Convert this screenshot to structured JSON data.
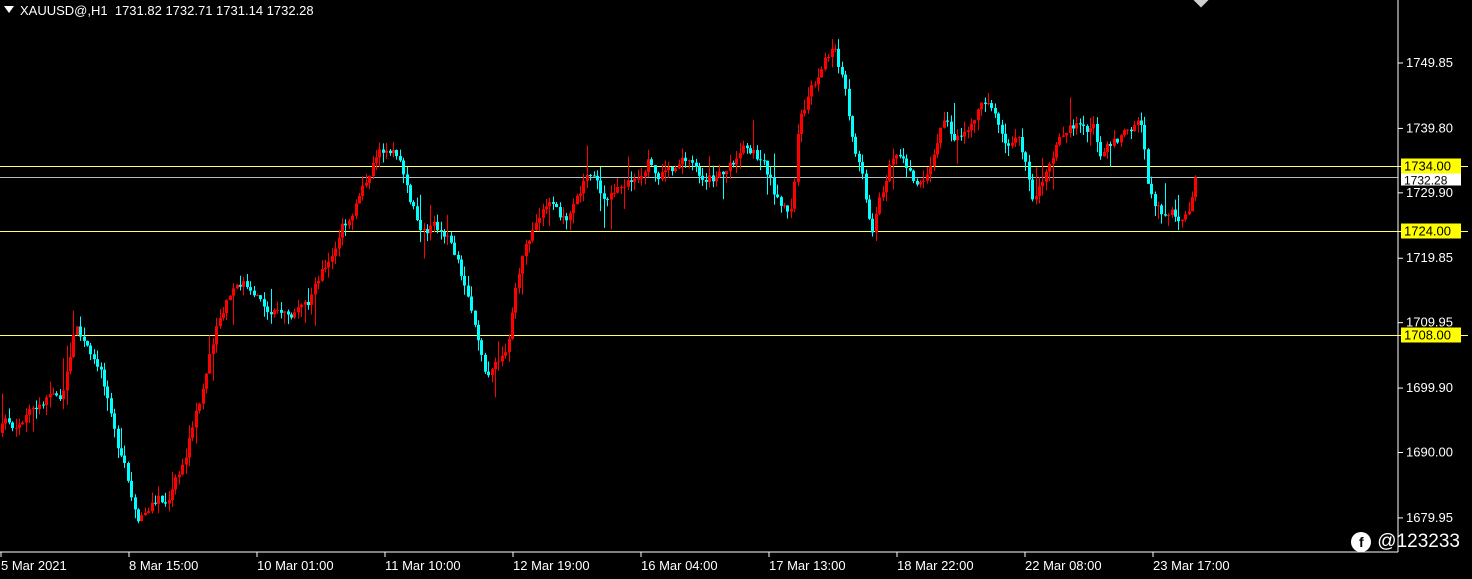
{
  "header": {
    "symbol": "XAUUSD@,H1",
    "ohlc": "1731.82 1732.71 1731.14 1732.28"
  },
  "watermark": {
    "handle": "@123233",
    "logo_letter": "f"
  },
  "colors": {
    "background": "#000000",
    "bull": "#ff0000",
    "bear": "#00ffff",
    "level_line": "#ffff66",
    "level_label_bg": "#ffff00",
    "text": "#ffffff"
  },
  "chart_data": {
    "type": "candlestick",
    "symbol": "XAUUSD@",
    "timeframe": "H1",
    "ylim": [
      1675,
      1760
    ],
    "y_ticks": [
      "1749.85",
      "1739.80",
      "1729.90",
      "1719.85",
      "1709.95",
      "1699.90",
      "1690.00",
      "1679.95"
    ],
    "x_labels": [
      "5 Mar 2021",
      "8 Mar 15:00",
      "10 Mar 01:00",
      "11 Mar 10:00",
      "12 Mar 19:00",
      "16 Mar 04:00",
      "17 Mar 13:00",
      "18 Mar 22:00",
      "22 Mar 08:00",
      "23 Mar 17:00"
    ],
    "current_price": "1732.28",
    "levels": [
      {
        "value": 1734.0,
        "label": "1734.00"
      },
      {
        "value": 1724.0,
        "label": "1724.00"
      },
      {
        "value": 1708.0,
        "label": "1708.00"
      }
    ],
    "close_path": [
      [
        0,
        1693
      ],
      [
        6,
        1696
      ],
      [
        12,
        1694
      ],
      [
        22,
        1695
      ],
      [
        30,
        1697
      ],
      [
        40,
        1697
      ],
      [
        50,
        1699
      ],
      [
        60,
        1698
      ],
      [
        68,
        1703
      ],
      [
        75,
        1710
      ],
      [
        80,
        1708
      ],
      [
        86,
        1707
      ],
      [
        92,
        1705
      ],
      [
        100,
        1703
      ],
      [
        110,
        1696
      ],
      [
        118,
        1691
      ],
      [
        124,
        1689
      ],
      [
        130,
        1684
      ],
      [
        138,
        1680
      ],
      [
        146,
        1681
      ],
      [
        158,
        1683
      ],
      [
        166,
        1682
      ],
      [
        175,
        1686
      ],
      [
        185,
        1689
      ],
      [
        192,
        1694
      ],
      [
        200,
        1698
      ],
      [
        210,
        1705
      ],
      [
        218,
        1710
      ],
      [
        228,
        1714
      ],
      [
        236,
        1716
      ],
      [
        244,
        1716
      ],
      [
        252,
        1715
      ],
      [
        262,
        1713
      ],
      [
        270,
        1711
      ],
      [
        280,
        1712
      ],
      [
        290,
        1711
      ],
      [
        300,
        1712
      ],
      [
        308,
        1713
      ],
      [
        316,
        1716
      ],
      [
        326,
        1719
      ],
      [
        334,
        1721
      ],
      [
        342,
        1725
      ],
      [
        350,
        1726
      ],
      [
        358,
        1729
      ],
      [
        366,
        1732
      ],
      [
        372,
        1734
      ],
      [
        378,
        1736
      ],
      [
        386,
        1737
      ],
      [
        394,
        1736
      ],
      [
        402,
        1734
      ],
      [
        410,
        1729
      ],
      [
        418,
        1725
      ],
      [
        426,
        1724
      ],
      [
        434,
        1725
      ],
      [
        442,
        1724
      ],
      [
        448,
        1723
      ],
      [
        456,
        1720
      ],
      [
        464,
        1716
      ],
      [
        472,
        1711
      ],
      [
        480,
        1706
      ],
      [
        486,
        1702
      ],
      [
        492,
        1703
      ],
      [
        500,
        1704
      ],
      [
        508,
        1707
      ],
      [
        514,
        1714
      ],
      [
        520,
        1719
      ],
      [
        526,
        1722
      ],
      [
        534,
        1725
      ],
      [
        542,
        1727
      ],
      [
        550,
        1728
      ],
      [
        558,
        1727
      ],
      [
        566,
        1725
      ],
      [
        574,
        1728
      ],
      [
        582,
        1731
      ],
      [
        590,
        1733
      ],
      [
        598,
        1731
      ],
      [
        606,
        1729
      ],
      [
        614,
        1730
      ],
      [
        622,
        1731
      ],
      [
        632,
        1732
      ],
      [
        642,
        1733
      ],
      [
        650,
        1735
      ],
      [
        658,
        1732
      ],
      [
        666,
        1734
      ],
      [
        674,
        1733
      ],
      [
        682,
        1735
      ],
      [
        690,
        1735
      ],
      [
        698,
        1733
      ],
      [
        706,
        1732
      ],
      [
        714,
        1732
      ],
      [
        722,
        1733
      ],
      [
        730,
        1734
      ],
      [
        738,
        1736
      ],
      [
        746,
        1737
      ],
      [
        754,
        1736
      ],
      [
        762,
        1735
      ],
      [
        770,
        1732
      ],
      [
        776,
        1729
      ],
      [
        782,
        1728
      ],
      [
        790,
        1727
      ],
      [
        794,
        1731
      ],
      [
        798,
        1740
      ],
      [
        804,
        1743
      ],
      [
        810,
        1746
      ],
      [
        818,
        1748
      ],
      [
        826,
        1751
      ],
      [
        834,
        1752
      ],
      [
        840,
        1749
      ],
      [
        846,
        1746
      ],
      [
        850,
        1740
      ],
      [
        856,
        1736
      ],
      [
        862,
        1733
      ],
      [
        868,
        1727
      ],
      [
        872,
        1724
      ],
      [
        878,
        1729
      ],
      [
        884,
        1731
      ],
      [
        892,
        1735
      ],
      [
        900,
        1736
      ],
      [
        906,
        1734
      ],
      [
        912,
        1732
      ],
      [
        918,
        1731
      ],
      [
        926,
        1733
      ],
      [
        934,
        1736
      ],
      [
        940,
        1740
      ],
      [
        946,
        1741
      ],
      [
        952,
        1738
      ],
      [
        958,
        1739
      ],
      [
        966,
        1739
      ],
      [
        974,
        1741
      ],
      [
        982,
        1744
      ],
      [
        990,
        1743
      ],
      [
        998,
        1741
      ],
      [
        1006,
        1737
      ],
      [
        1014,
        1738
      ],
      [
        1020,
        1738
      ],
      [
        1026,
        1734
      ],
      [
        1032,
        1729
      ],
      [
        1038,
        1730
      ],
      [
        1046,
        1733
      ],
      [
        1054,
        1736
      ],
      [
        1062,
        1739
      ],
      [
        1070,
        1740
      ],
      [
        1078,
        1741
      ],
      [
        1086,
        1739
      ],
      [
        1094,
        1740
      ],
      [
        1100,
        1736
      ],
      [
        1108,
        1737
      ],
      [
        1116,
        1738
      ],
      [
        1124,
        1739
      ],
      [
        1132,
        1740
      ],
      [
        1140,
        1741
      ],
      [
        1144,
        1737
      ],
      [
        1148,
        1731
      ],
      [
        1154,
        1728
      ],
      [
        1162,
        1727
      ],
      [
        1170,
        1727
      ],
      [
        1178,
        1726
      ],
      [
        1184,
        1726
      ],
      [
        1190,
        1728
      ],
      [
        1196,
        1732.28
      ]
    ]
  }
}
